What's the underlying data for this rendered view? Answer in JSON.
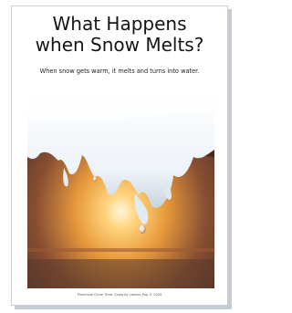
{
  "document": {
    "title": "What Happens\nwhen Snow Melts?",
    "subtitle": "When snow gets warm, it melts and turns into water.",
    "footer": "Preschool Circle Time: Snow by Lavinia Pop © 2020"
  }
}
